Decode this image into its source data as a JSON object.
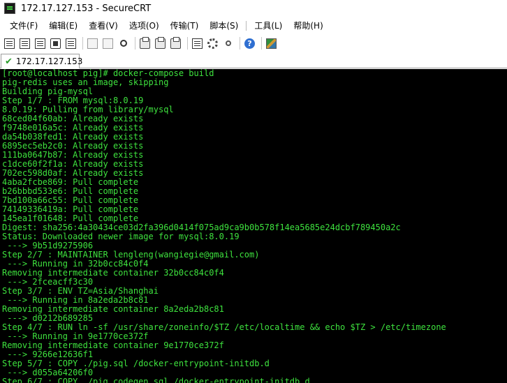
{
  "window": {
    "title": "172.17.127.153 - SecureCRT"
  },
  "menu": [
    {
      "label": "文件(F)"
    },
    {
      "label": "编辑(E)"
    },
    {
      "label": "查看(V)"
    },
    {
      "label": "选项(O)"
    },
    {
      "label": "传输(T)"
    },
    {
      "label": "脚本(S)"
    },
    {
      "label": "工具(L)"
    },
    {
      "label": "帮助(H)"
    }
  ],
  "toolbar": {
    "buttons": [
      "connect-icon",
      "quick-connect-icon",
      "connect-in-tab-icon",
      "reconnect-icon",
      "disconnect-icon",
      "copy-icon",
      "paste-icon",
      "find-icon",
      "print-icon",
      "print-selection-icon",
      "print-setup-icon",
      "session-options-icon",
      "global-options-icon",
      "keymap-icon",
      "help-icon",
      "sftp-map-icon"
    ]
  },
  "tab": {
    "label": "172.17.127.153"
  },
  "colors": {
    "terminal_bg": "#000000",
    "terminal_fg": "#3ee23e",
    "tab_check": "#2b9d2b"
  },
  "terminal": {
    "lines": [
      "[root@localhost pig]# docker-compose build",
      "pig-redis uses an image, skipping",
      "Building pig-mysql",
      "Step 1/7 : FROM mysql:8.0.19",
      "8.0.19: Pulling from library/mysql",
      "68ced04f60ab: Already exists",
      "f9748e016a5c: Already exists",
      "da54b038fed1: Already exists",
      "6895ec5eb2c0: Already exists",
      "111ba0647b87: Already exists",
      "c1dce60f2f1a: Already exists",
      "702ec598d0af: Already exists",
      "4aba2fcbe869: Pull complete",
      "b26bbbd533e6: Pull complete",
      "7bd100a66c55: Pull complete",
      "74149336419a: Pull complete",
      "145ea1f01648: Pull complete",
      "Digest: sha256:4a30434ce03d2fa396d0414f075ad9ca9b0b578f14ea5685e24dcbf789450a2c",
      "Status: Downloaded newer image for mysql:8.0.19",
      " ---> 9b51d9275906",
      "Step 2/7 : MAINTAINER lengleng(wangiegie@gmail.com)",
      " ---> Running in 32b0cc84c0f4",
      "Removing intermediate container 32b0cc84c0f4",
      " ---> 2fceacff3c30",
      "Step 3/7 : ENV TZ=Asia/Shanghai",
      " ---> Running in 8a2eda2b8c81",
      "Removing intermediate container 8a2eda2b8c81",
      " ---> d0212b689285",
      "Step 4/7 : RUN ln -sf /usr/share/zoneinfo/$TZ /etc/localtime && echo $TZ > /etc/timezone",
      " ---> Running in 9e1770ce372f",
      "Removing intermediate container 9e1770ce372f",
      " ---> 9266e12636f1",
      "Step 5/7 : COPY ./pig.sql /docker-entrypoint-initdb.d",
      " ---> d055a64206f0",
      "Step 6/7 : COPY ./pig_codegen.sql /docker-entrypoint-initdb.d"
    ]
  }
}
